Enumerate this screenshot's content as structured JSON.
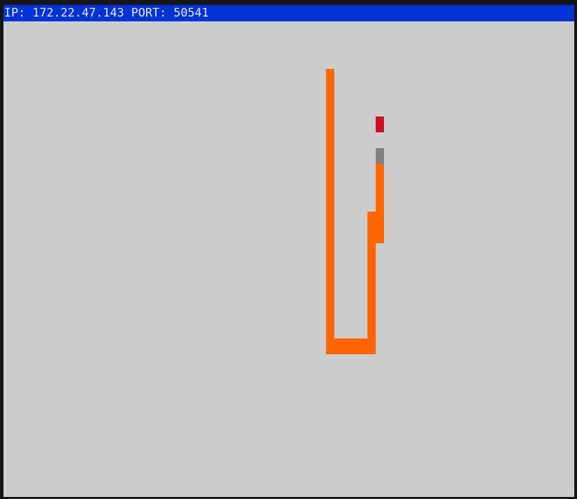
{
  "status_bar": {
    "ip_label": "IP:",
    "ip_value": "172.22.47.143",
    "port_label": "PORT:",
    "port_value": "50541"
  },
  "colors": {
    "background": "#cdcdcd",
    "status_bar": "#0033d4",
    "status_text": "#e6e6e6",
    "snake_body": "#ff6600",
    "snake_head": "#808080",
    "food": "#cc1122"
  },
  "game": {
    "snake_head": {
      "col": 45,
      "row": 8
    },
    "snake_body": [
      [
        45,
        9
      ],
      [
        45,
        10
      ],
      [
        45,
        11
      ],
      [
        45,
        12
      ],
      [
        45,
        13
      ],
      [
        44,
        12
      ],
      [
        44,
        13
      ],
      [
        44,
        14
      ],
      [
        44,
        15
      ],
      [
        44,
        16
      ],
      [
        44,
        17
      ],
      [
        44,
        18
      ],
      [
        44,
        19
      ],
      [
        44,
        20
      ],
      [
        43,
        20
      ],
      [
        42,
        20
      ],
      [
        41,
        20
      ],
      [
        40,
        20
      ],
      [
        39,
        20
      ],
      [
        39,
        19
      ],
      [
        39,
        18
      ],
      [
        39,
        17
      ],
      [
        39,
        16
      ],
      [
        39,
        15
      ],
      [
        39,
        14
      ],
      [
        39,
        13
      ],
      [
        39,
        12
      ],
      [
        39,
        11
      ],
      [
        39,
        10
      ],
      [
        39,
        9
      ],
      [
        39,
        8
      ],
      [
        39,
        7
      ],
      [
        39,
        6
      ],
      [
        39,
        5
      ],
      [
        39,
        4
      ],
      [
        39,
        3
      ]
    ],
    "food": {
      "col": 45,
      "row": 6
    }
  }
}
